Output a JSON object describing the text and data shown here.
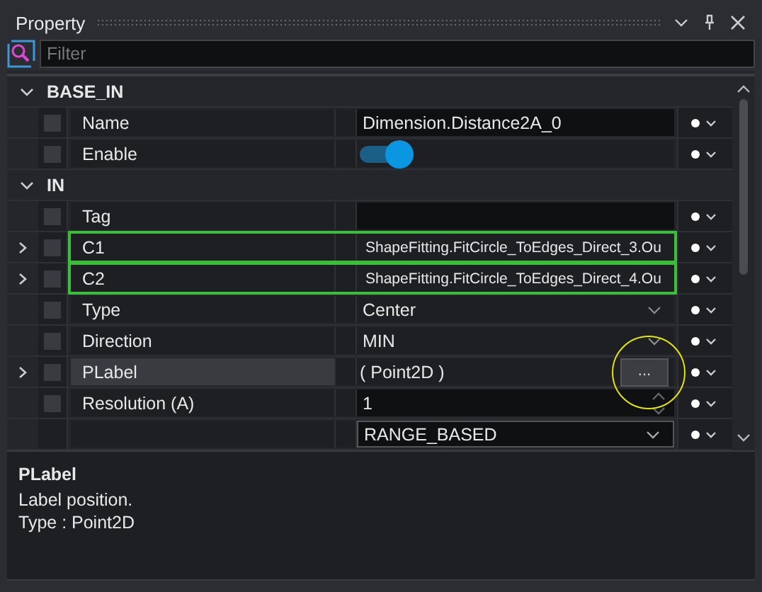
{
  "panel": {
    "title": "Property"
  },
  "filter": {
    "placeholder": "Filter"
  },
  "groups": [
    {
      "name": "BASE_IN",
      "expanded": true,
      "rows": [
        {
          "name": "Name",
          "kind": "field",
          "value": "Dimension.Distance2A_0",
          "checked": false,
          "expandable": false,
          "highlighted": false,
          "selected": false
        },
        {
          "name": "Enable",
          "kind": "toggle",
          "on": true,
          "checked": false,
          "expandable": false,
          "highlighted": false,
          "selected": false
        }
      ]
    },
    {
      "name": "IN",
      "expanded": true,
      "rows": [
        {
          "name": "Tag",
          "kind": "field",
          "value": "",
          "checked": false,
          "expandable": false,
          "highlighted": false,
          "selected": false
        },
        {
          "name": "C1",
          "kind": "link",
          "value": "ShapeFitting.FitCircle_ToEdges_Direct_3.Ou",
          "checked": false,
          "expandable": true,
          "highlighted": true,
          "selected": false
        },
        {
          "name": "C2",
          "kind": "link",
          "value": "ShapeFitting.FitCircle_ToEdges_Direct_4.Ou",
          "checked": false,
          "expandable": true,
          "highlighted": true,
          "selected": false
        },
        {
          "name": "Type",
          "kind": "dropdown",
          "value": "Center",
          "checked": false,
          "expandable": false,
          "highlighted": false,
          "selected": false
        },
        {
          "name": "Direction",
          "kind": "dropdown",
          "value": "MIN",
          "checked": false,
          "expandable": false,
          "highlighted": false,
          "selected": false
        },
        {
          "name": "PLabel",
          "kind": "object",
          "value": "( Point2D )",
          "button": "...",
          "pointer_ring": true,
          "checked": false,
          "expandable": true,
          "highlighted": false,
          "selected": true
        },
        {
          "name": "Resolution (A)",
          "kind": "number",
          "value": "1",
          "checked": false,
          "expandable": false,
          "highlighted": false,
          "selected": false
        },
        {
          "kind": "combo",
          "value": "RANGE_BASED",
          "expandable": false,
          "highlighted": false,
          "selected": false
        }
      ]
    }
  ],
  "description": {
    "title": "PLabel",
    "lines": [
      "Label position.",
      "Type : Point2D"
    ]
  }
}
